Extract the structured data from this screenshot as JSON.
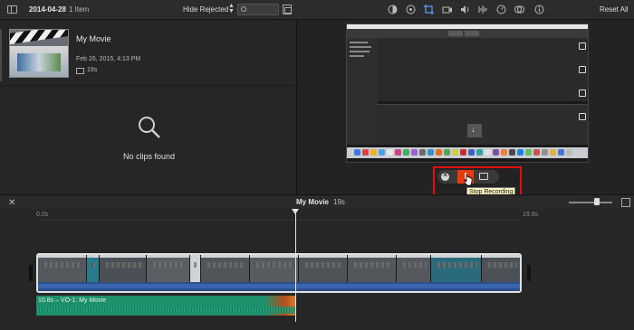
{
  "toolbar": {
    "event_title": "2014-04-28",
    "item_count": "1 Item",
    "hide_rejected": "Hide Rejected",
    "reset_all": "Reset All"
  },
  "browser": {
    "clip": {
      "title": "My Movie",
      "date": "Feb 26, 2015, 4:13 PM",
      "duration": "19s"
    },
    "empty_message": "No clips found"
  },
  "viewer": {
    "recording_tooltip": "Stop Recording"
  },
  "timeline": {
    "title": "My Movie",
    "duration": "19s",
    "ruler_start": "0.0s",
    "ruler_end": "19.8s",
    "audio_clip_label": "10.8s – VO-1: My Movie"
  },
  "colors": {
    "record_highlight": "#e01010",
    "stop_button": "#e83a0e",
    "audio_track": "#1e8f6b",
    "video_track": "#2d4f8c"
  }
}
